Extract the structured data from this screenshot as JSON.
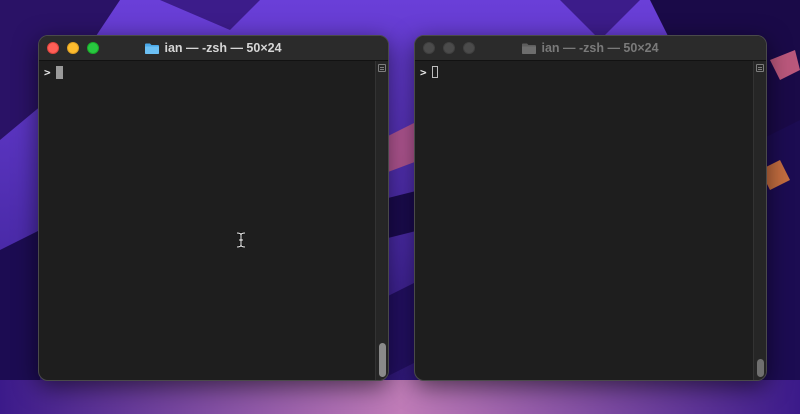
{
  "desktop": {
    "wallpaper": "purple-abstract-landscape",
    "colors": {
      "sky": "#5a2fc4",
      "deep": "#2b1670",
      "accent_pink": "#e46b8a",
      "accent_orange": "#f0873c"
    }
  },
  "windows": [
    {
      "id": "left",
      "state": "active",
      "title": "ian — -zsh — 50×24",
      "icon": "folder-icon",
      "prompt": ">",
      "cursor_style": "block",
      "pointer": "ibeam-cursor-icon"
    },
    {
      "id": "right",
      "state": "inactive",
      "title": "ian — -zsh — 50×24",
      "icon": "folder-icon",
      "prompt": ">",
      "cursor_style": "hollow"
    }
  ],
  "colors": {
    "terminal_bg": "#1e1e1e",
    "titlebar_bg": "#2b2b2b",
    "close": "#ff5f57",
    "minimize": "#febc2e",
    "zoom": "#28c840"
  }
}
